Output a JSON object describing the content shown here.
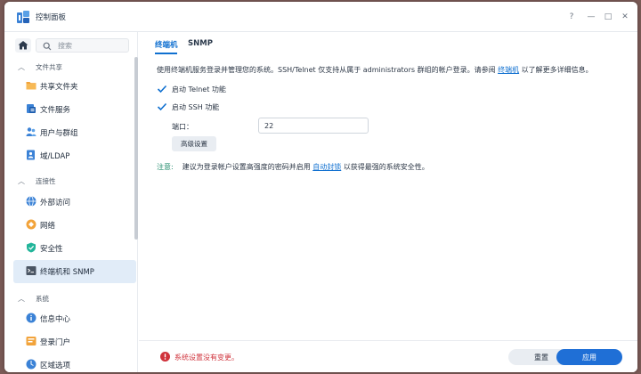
{
  "window": {
    "title": "控制面板",
    "controls": {
      "help": "?",
      "minimize": "—",
      "maximize": "□",
      "close": "✕"
    }
  },
  "sidebar": {
    "search_placeholder": "搜索",
    "groups": [
      {
        "label": "文件共享",
        "items": [
          {
            "label": "共享文件夹",
            "icon": "shared-folder-icon"
          },
          {
            "label": "文件服务",
            "icon": "file-services-icon"
          },
          {
            "label": "用户与群组",
            "icon": "users-groups-icon"
          },
          {
            "label": "域/LDAP",
            "icon": "domain-ldap-icon"
          }
        ]
      },
      {
        "label": "连接性",
        "items": [
          {
            "label": "外部访问",
            "icon": "external-access-icon"
          },
          {
            "label": "网络",
            "icon": "network-icon"
          },
          {
            "label": "安全性",
            "icon": "security-icon"
          },
          {
            "label": "终端机和 SNMP",
            "icon": "terminal-snmp-icon",
            "active": true
          }
        ]
      },
      {
        "label": "系统",
        "items": [
          {
            "label": "信息中心",
            "icon": "info-center-icon"
          },
          {
            "label": "登录门户",
            "icon": "login-portal-icon"
          },
          {
            "label": "区域选项",
            "icon": "regional-options-icon"
          }
        ]
      }
    ]
  },
  "main": {
    "tabs": [
      {
        "label": "终端机",
        "active": true
      },
      {
        "label": "SNMP",
        "active": false
      }
    ],
    "description_prefix": "使用终端机服务登录并管理您的系统。SSH/Telnet 仅支持从属于 administrators 群组的帐户登录。请参阅 ",
    "description_link": "终端机",
    "description_suffix": " 以了解更多详细信息。",
    "telnet_label": "启动 Telnet 功能",
    "telnet_checked": true,
    "ssh_label": "启动 SSH 功能",
    "ssh_checked": true,
    "port_label": "端口：",
    "port_value": "22",
    "advanced_button": "高级设置",
    "note_label": "注意:",
    "note_prefix": "建议为登录帐户设置高强度的密码并启用 ",
    "note_link": "自动封锁",
    "note_suffix": " 以获得最强的系统安全性。"
  },
  "footer": {
    "status_text": "系统设置没有变更。",
    "reset_button": "重置",
    "apply_button": "应用"
  },
  "colors": {
    "accent": "#1070d0",
    "apply_button": "#1f6fd6",
    "status_error": "#d0333c",
    "note_label": "#1e8a6a",
    "active_nav_bg": "#e1ecf8"
  }
}
